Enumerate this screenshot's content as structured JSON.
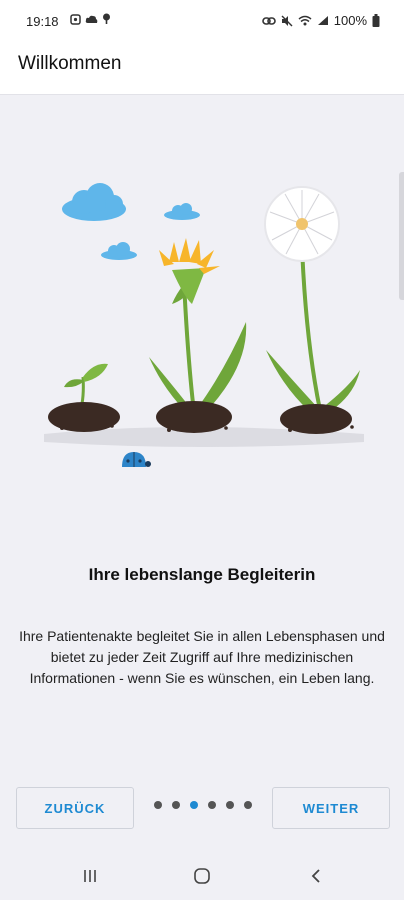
{
  "status": {
    "time": "19:18",
    "battery": "100%",
    "icons_left": [
      "photo-icon",
      "cloud-icon",
      "location-icon"
    ],
    "icons_right": [
      "link-icon",
      "mute-icon",
      "wifi-icon",
      "signal-icon",
      "battery-icon"
    ]
  },
  "appbar": {
    "title": "Willkommen"
  },
  "onboarding": {
    "headline": "Ihre lebenslange Begleiterin",
    "description": "Ihre Patientenakte begleitet Sie in allen Lebensphasen und bietet zu jeder Zeit Zugriff auf Ihre medizinischen Informationen - wenn Sie es wünschen, ein Leben lang.",
    "page_count": 6,
    "active_page": 3
  },
  "buttons": {
    "back": "ZURÜCK",
    "next": "WEITER"
  },
  "colors": {
    "accent": "#1e8ad2",
    "background": "#f0f0f5",
    "cloud": "#5fb6ea",
    "leaf": "#6fa63a",
    "flower": "#f7b52a"
  },
  "navbar": {
    "icons": [
      "recent-apps-icon",
      "home-icon",
      "back-icon"
    ]
  }
}
